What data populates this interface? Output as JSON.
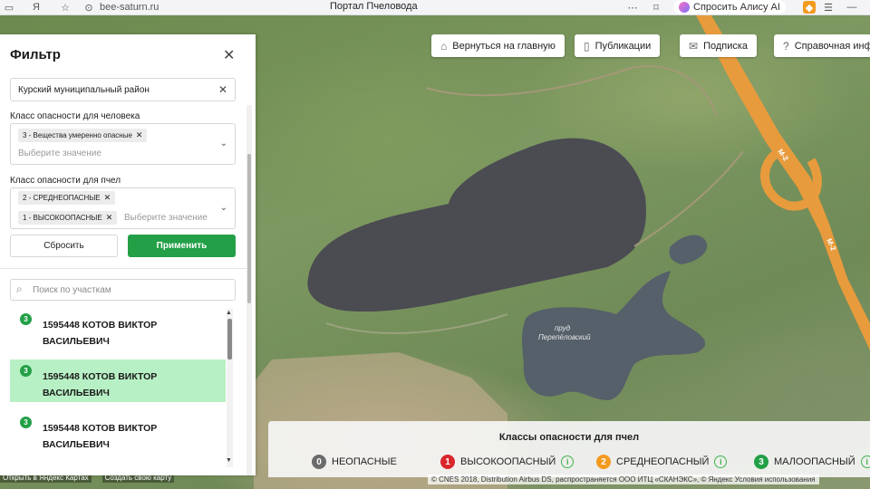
{
  "browser": {
    "url": "bee-saturn.ru",
    "title": "Портал Пчеловода",
    "alice_label": "Спросить Алису AI"
  },
  "topnav": {
    "home": "Вернуться на главную",
    "publications": "Публикации",
    "subscribe": "Подписка",
    "help": "Справочная инфо"
  },
  "filter": {
    "title": "Фильтр",
    "district_value": "Курский муниципальный район",
    "human_label": "Класс опасности для человека",
    "human_chip": "3 - Вещества умеренно опасные",
    "human_placeholder": "Выберите значение",
    "bee_label": "Класс опасности для пчел",
    "bee_chips": [
      "2 - СРЕДНЕОПАСНЫЕ",
      "1 - ВЫСОКООПАСНЫЕ"
    ],
    "bee_placeholder": "Выберите значение",
    "reset": "Сбросить",
    "apply": "Применить",
    "search_placeholder": "Поиск по участкам"
  },
  "list": {
    "items": [
      {
        "badge": "3",
        "text": "1595448 КОТОВ ВИКТОР ВАСИЛЬЕВИЧ"
      },
      {
        "badge": "3",
        "text": "1595448 КОТОВ ВИКТОР ВАСИЛЬЕВИЧ"
      },
      {
        "badge": "3",
        "text": "1595448 КОТОВ ВИКТОР ВАСИЛЬЕВИЧ"
      }
    ]
  },
  "map": {
    "pond_label_1": "пруд",
    "pond_label_2": "Перепёловский",
    "road_label": "М-2",
    "copyright": "© CNES 2018, Distribution Airbus DS, распространяется ООО ИТЦ «СКАНЭКС», © Яндекс Условия использования",
    "open_link": "Открыть в Яндекс Картах",
    "create_link": "Создать свою карту"
  },
  "legend": {
    "title": "Классы опасности для пчел",
    "items": [
      {
        "num": "0",
        "label": "НЕОПАСНЫЕ",
        "color": "#6b6b6b"
      },
      {
        "num": "1",
        "label": "ВЫСОКООПАСНЫЙ",
        "color": "#d9262b"
      },
      {
        "num": "2",
        "label": "СРЕДНЕОПАСНЫЙ",
        "color": "#f39a1f"
      },
      {
        "num": "3",
        "label": "МАЛООПАСНЫЙ",
        "color": "#23a047"
      }
    ]
  }
}
